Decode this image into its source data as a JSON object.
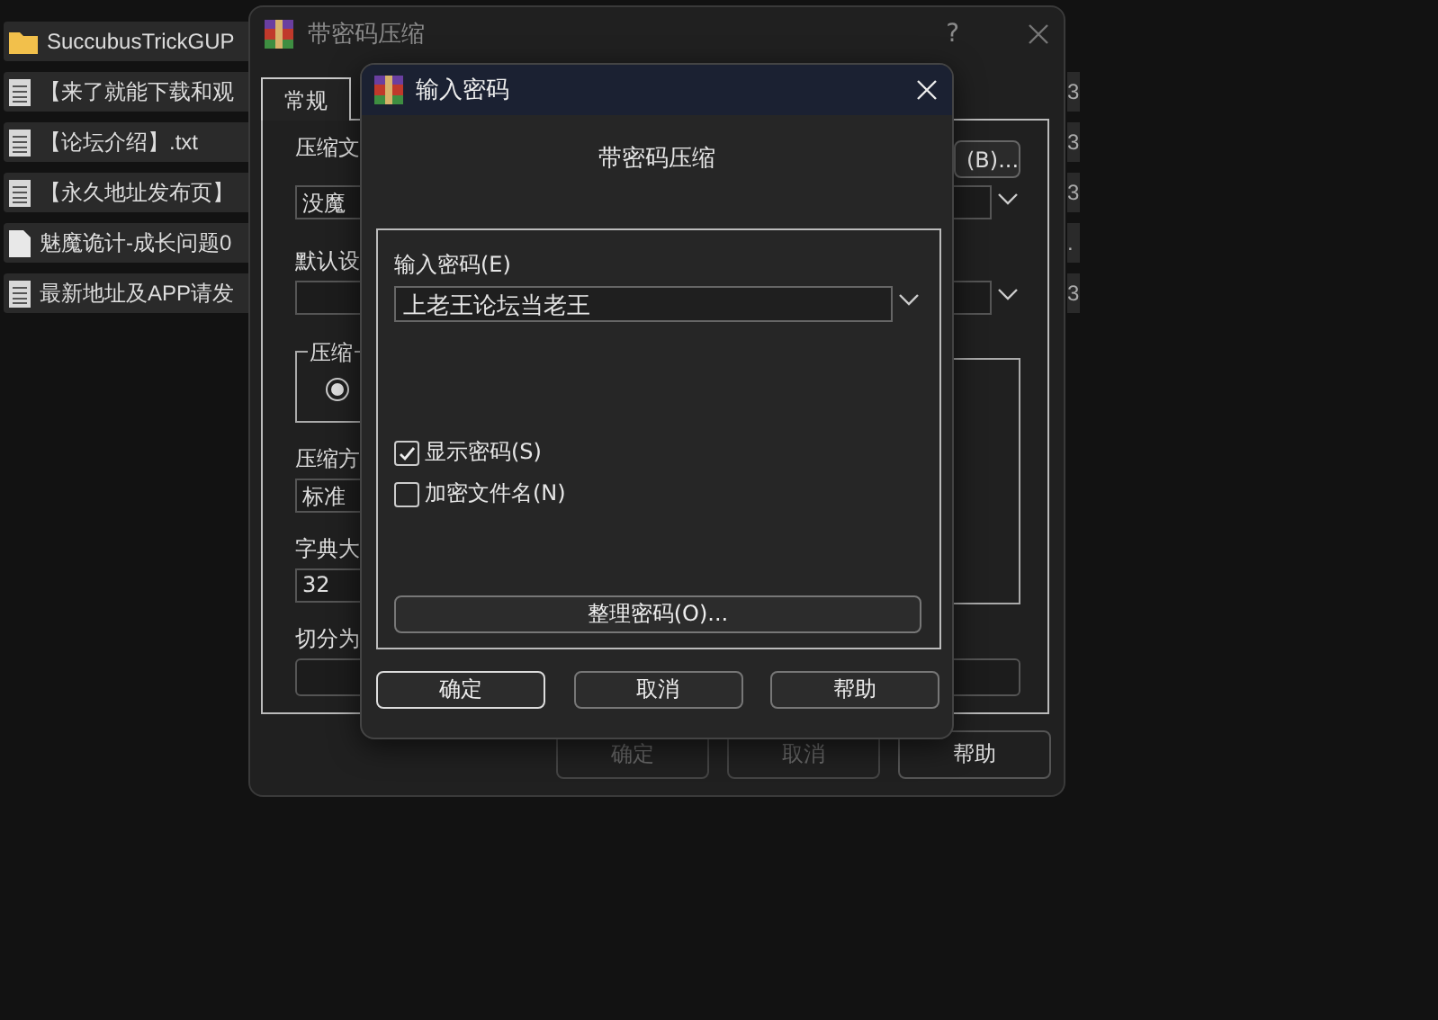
{
  "file_list": {
    "items": [
      {
        "kind": "folder",
        "name": "SuccubusTrickGUP"
      },
      {
        "kind": "text",
        "name": "【来了就能下载和观",
        "column_2": "3"
      },
      {
        "kind": "text",
        "name": "【论坛介绍】.txt",
        "column_2": "3"
      },
      {
        "kind": "text",
        "name": "【永久地址发布页】",
        "column_2": "3"
      },
      {
        "kind": "blank",
        "name": "魅魔诡计-成长问题0",
        "column_2": "."
      },
      {
        "kind": "text",
        "name": "最新地址及APP请发",
        "column_2": "3"
      }
    ]
  },
  "back_dialog": {
    "title": "带密码压缩",
    "help": "?",
    "tabs": [
      {
        "label": "常规",
        "selected": true
      }
    ],
    "label_1": "压缩文",
    "browse_button": "(B)...",
    "archive_name": "没魔",
    "label_2": "默认设",
    "group": {
      "label": "压缩",
      "radio_checked": true
    },
    "label_3": "压缩方",
    "method": "标准",
    "label_4": "字典大",
    "dictionary": "32",
    "label_5": "切分为",
    "buttons": [
      {
        "label": "确定",
        "disabled": true
      },
      {
        "label": "取消",
        "disabled": true
      },
      {
        "label": "帮助",
        "disabled": false
      }
    ]
  },
  "password_dialog": {
    "title": "输入密码",
    "heading": "带密码压缩",
    "field_label": "输入密码(E)",
    "password": "上老王论坛当老王",
    "options": [
      {
        "label": "显示密码(S)",
        "checked": true
      },
      {
        "label": "加密文件名(N)",
        "checked": false
      }
    ],
    "organize_button": "整理密码(O)...",
    "buttons": [
      {
        "label": "确定",
        "default": true
      },
      {
        "label": "取消",
        "default": false
      },
      {
        "label": "帮助",
        "default": false
      }
    ]
  }
}
